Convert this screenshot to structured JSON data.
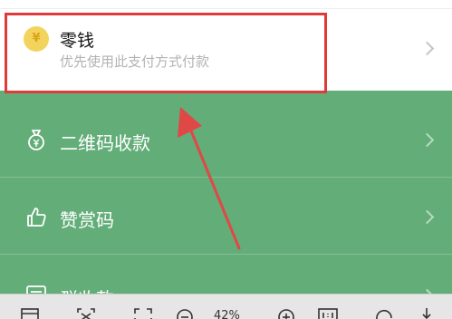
{
  "wallet": {
    "coin_symbol": "¥",
    "title": "零钱",
    "subtitle": "优先使用此支付方式付款"
  },
  "menu": {
    "items": [
      {
        "label": "二维码收款",
        "icon": "money-bag-icon"
      },
      {
        "label": "赞赏码",
        "icon": "thumbs-up-icon"
      },
      {
        "label": "群收款",
        "icon": "group-receipt-icon"
      }
    ]
  },
  "toolbar": {
    "zoom": "42%",
    "icons": [
      "window-icon",
      "fit-icon",
      "crop-icon",
      "zoom-out-icon",
      "zoom-in-icon",
      "actual-size-icon",
      "rotate-icon",
      "download-icon"
    ]
  },
  "colors": {
    "green_bg": "#62ad78",
    "highlight": "#e03b3b",
    "arrow": "#e04848"
  }
}
